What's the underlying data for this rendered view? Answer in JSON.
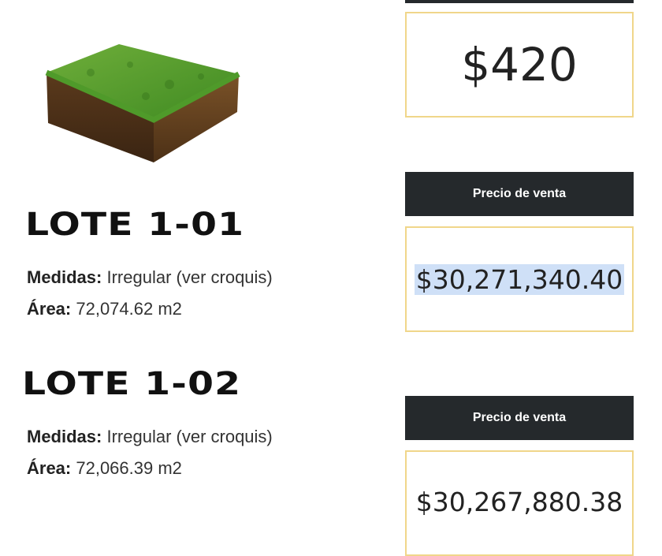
{
  "top_price": "$420",
  "lots": [
    {
      "title": "LOTE  1-01",
      "measures_label": "Medidas:",
      "measures_value": " Irregular (ver croquis)",
      "area_label": "Área:",
      "area_value": " 72,074.62 m2",
      "price_header": "Precio de venta",
      "price": "$30,271,340.40"
    },
    {
      "title": "LOTE  1-02",
      "measures_label": "Medidas:",
      "measures_value": " Irregular (ver croquis)",
      "area_label": "Área:",
      "area_value": " 72,066.39 m2",
      "price_header": "Precio de venta",
      "price": "$30,267,880.38"
    }
  ],
  "colors": {
    "dark_bar": "#25292c",
    "box_border": "#f0d68a",
    "selection": "#cfe0f7"
  },
  "images": {
    "land": "grass-soil-cube-icon"
  }
}
